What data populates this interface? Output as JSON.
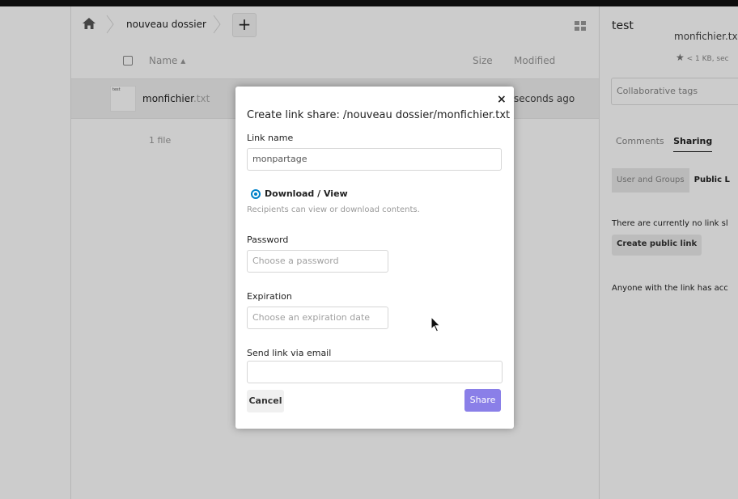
{
  "breadcrumb": {
    "home_icon": "home-icon",
    "folder": "nouveau dossier",
    "add_label": "+"
  },
  "file_list": {
    "columns": {
      "name": "Name ▴",
      "size": "Size",
      "modified": "Modified"
    },
    "rows": [
      {
        "thumb_label": "test",
        "name": "monfichier",
        "ext": ".txt",
        "modified": "seconds ago"
      }
    ],
    "summary": "1 file"
  },
  "sidebar": {
    "title": "test",
    "filename": "monfichier.tx",
    "meta": "< 1 KB, sec",
    "star_icon": "star-icon",
    "tags_placeholder": "Collaborative tags",
    "tabs": [
      "Comments",
      "Sharing"
    ],
    "active_tab": "Sharing",
    "subtabs": [
      "User and Groups",
      "Public L"
    ],
    "active_subtab": "Public L",
    "no_links_text": "There are currently no link sl",
    "create_button": "Create public link",
    "anyone_text": "Anyone with the link has acc"
  },
  "modal": {
    "close_label": "×",
    "title": "Create link share: /nouveau dossier/monfichier.txt",
    "link_name_label": "Link name",
    "link_name_value": "monpartage",
    "permission_label": "Download / View",
    "permission_hint": "Recipients can view or download contents.",
    "password_label": "Password",
    "password_placeholder": "Choose a password",
    "expiration_label": "Expiration",
    "expiration_placeholder": "Choose an expiration date",
    "email_label": "Send link via email",
    "email_value": "",
    "cancel_label": "Cancel",
    "share_label": "Share"
  },
  "colors": {
    "accent": "#0082c9",
    "share_button": "#8a7fe8",
    "top_bar": "#111111"
  }
}
